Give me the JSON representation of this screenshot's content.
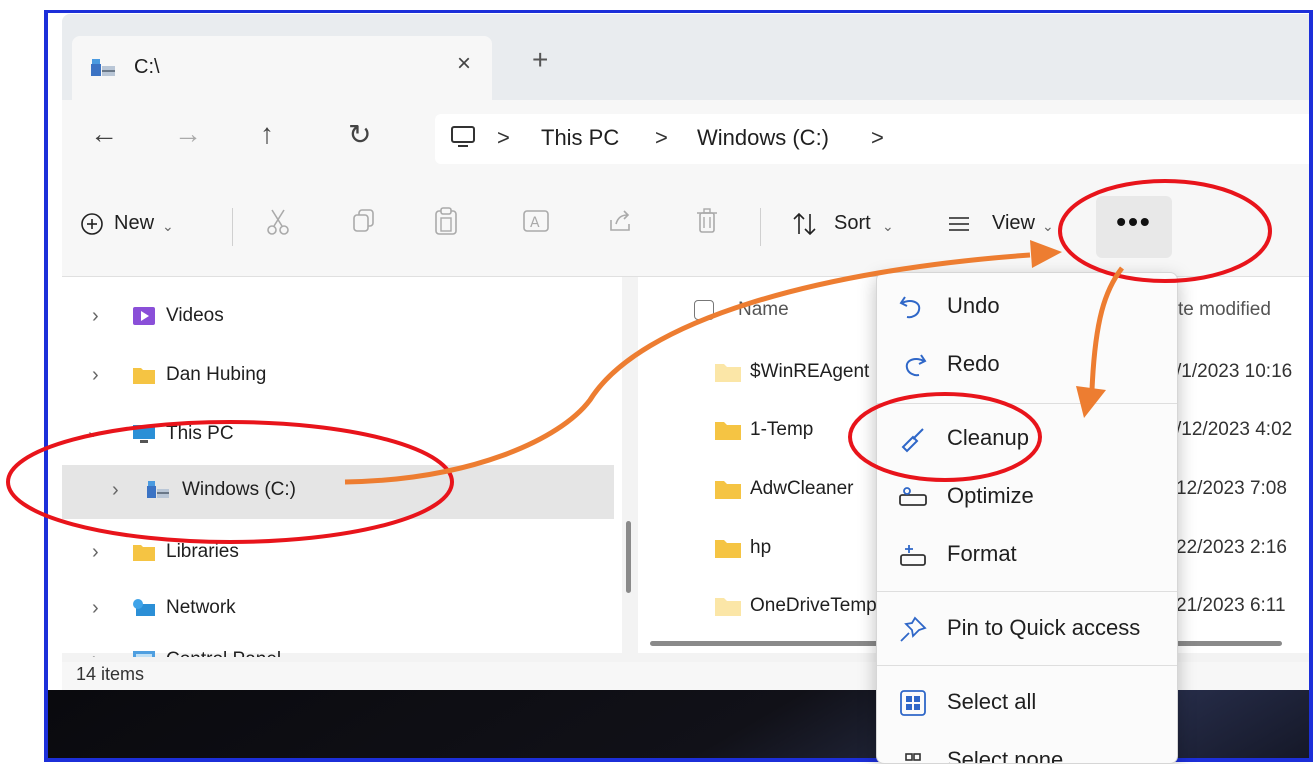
{
  "tab": {
    "title": "C:\\",
    "close_glyph": "×",
    "new_glyph": "+"
  },
  "nav": {
    "back": "←",
    "forward": "→",
    "up": "↑",
    "refresh": "↻"
  },
  "breadcrumb": {
    "items": [
      "This PC",
      "Windows (C:)"
    ],
    "sep": ">"
  },
  "toolbar": {
    "new_label": "New",
    "sort_label": "Sort",
    "view_label": "View",
    "more_glyph": "•••",
    "icons": [
      "cut-icon",
      "copy-icon",
      "paste-icon",
      "rename-icon",
      "share-icon",
      "delete-icon"
    ]
  },
  "sidebar": {
    "items": [
      {
        "label": "Videos",
        "icon": "videos-icon",
        "expanded": false
      },
      {
        "label": "Dan Hubing",
        "icon": "folder-icon",
        "expanded": false
      },
      {
        "label": "This PC",
        "icon": "this-pc-icon",
        "expanded": true
      },
      {
        "label": "Windows (C:)",
        "icon": "drive-icon",
        "expanded": false,
        "selected": true
      },
      {
        "label": "Libraries",
        "icon": "folder-icon",
        "expanded": false
      },
      {
        "label": "Network",
        "icon": "network-icon",
        "expanded": false
      },
      {
        "label": "Control Panel",
        "icon": "control-panel-icon",
        "expanded": false
      }
    ]
  },
  "files": {
    "header": {
      "name": "Name",
      "date": "te modified"
    },
    "rows": [
      {
        "name": "$WinREAgent",
        "date": "/1/2023 10:16"
      },
      {
        "name": "1-Temp",
        "date": "/12/2023 4:02"
      },
      {
        "name": "AdwCleaner",
        "date": "12/2023 7:08"
      },
      {
        "name": "hp",
        "date": "22/2023 2:16"
      },
      {
        "name": "OneDriveTemp",
        "date": "21/2023 6:11"
      }
    ]
  },
  "status": {
    "count": "14 items"
  },
  "menu": {
    "items": [
      {
        "label": "Undo",
        "icon": "undo-icon"
      },
      {
        "label": "Redo",
        "icon": "redo-icon"
      },
      {
        "label": "Cleanup",
        "icon": "cleanup-broom-icon"
      },
      {
        "label": "Optimize",
        "icon": "optimize-icon"
      },
      {
        "label": "Format",
        "icon": "format-icon"
      },
      {
        "label": "Pin to Quick access",
        "icon": "pin-icon"
      },
      {
        "label": "Select all",
        "icon": "select-all-icon"
      },
      {
        "label": "Select none",
        "icon": "select-none-icon"
      }
    ]
  },
  "colors": {
    "annotation_red": "#e8141b",
    "annotation_orange": "#ed7d31",
    "frame_blue": "#1c2fd9",
    "folder_yellow": "#f5c443"
  }
}
